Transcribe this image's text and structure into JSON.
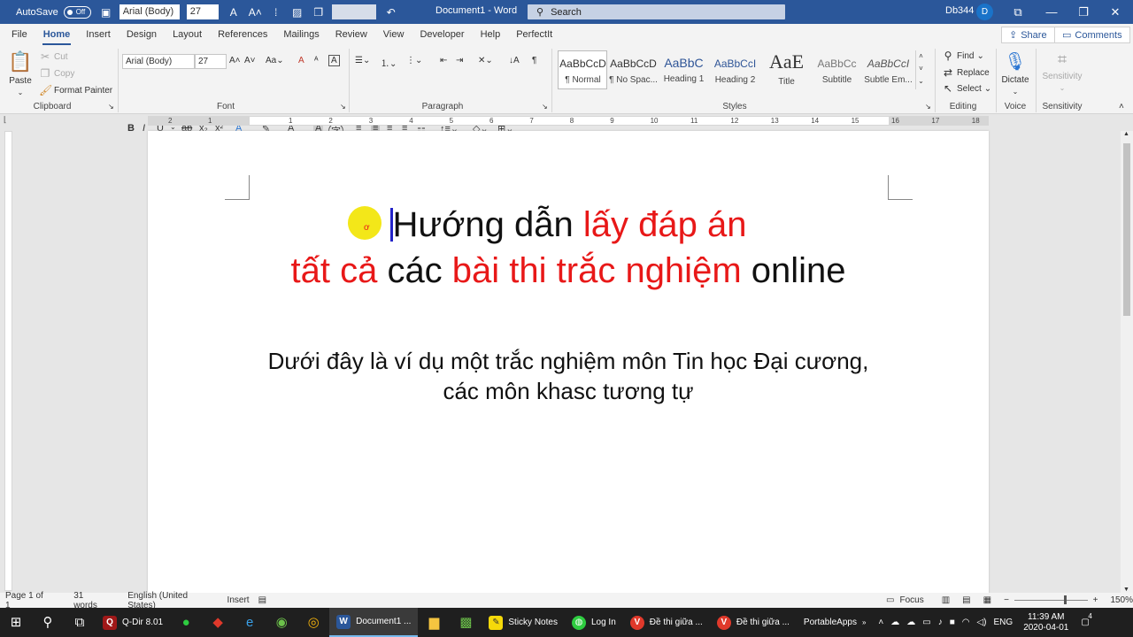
{
  "titlebar": {
    "autosave_label": "AutoSave",
    "autosave_state": "Off",
    "font_name": "Arial (Body)",
    "font_size": "27",
    "doc_title": "Document1 - Word",
    "search_placeholder": "Search",
    "user": "Db344",
    "avatar_initial": "D"
  },
  "menu": {
    "tabs": [
      "File",
      "Home",
      "Insert",
      "Design",
      "Layout",
      "References",
      "Mailings",
      "Review",
      "View",
      "Developer",
      "Help",
      "PerfectIt"
    ],
    "share": "Share",
    "comments": "Comments"
  },
  "ribbon": {
    "clipboard": {
      "paste": "Paste",
      "cut": "Cut",
      "copy": "Copy",
      "format_painter": "Format Painter",
      "label": "Clipboard"
    },
    "font": {
      "name": "Arial (Body)",
      "size": "27",
      "label": "Font"
    },
    "paragraph": {
      "label": "Paragraph"
    },
    "styles": {
      "label": "Styles",
      "items": [
        {
          "sample": "AaBbCcD",
          "name": "¶ Normal"
        },
        {
          "sample": "AaBbCcD",
          "name": "¶ No Spac..."
        },
        {
          "sample": "AaBbC",
          "name": "Heading 1"
        },
        {
          "sample": "AaBbCcI",
          "name": "Heading 2"
        },
        {
          "sample": "AaE",
          "name": "Title"
        },
        {
          "sample": "AaBbCc",
          "name": "Subtitle"
        },
        {
          "sample": "AaBbCcI",
          "name": "Subtle Em..."
        }
      ]
    },
    "editing": {
      "find": "Find",
      "replace": "Replace",
      "select": "Select",
      "label": "Editing"
    },
    "voice": {
      "dictate": "Dictate",
      "label": "Voice"
    },
    "sensitivity": {
      "button": "Sensitivity",
      "label": "Sensitivity"
    }
  },
  "ruler": {
    "marks": [
      "2",
      "1",
      "1",
      "2",
      "3",
      "4",
      "5",
      "6",
      "7",
      "8",
      "9",
      "10",
      "11",
      "12",
      "13",
      "14",
      "15",
      "16",
      "17",
      "18"
    ]
  },
  "document": {
    "heading_line1": [
      {
        "text": "Hướng dẫn ",
        "color": "black"
      },
      {
        "text": "lấy đáp án",
        "color": "red"
      }
    ],
    "heading_line2": [
      {
        "text": "tất cả ",
        "color": "red"
      },
      {
        "text": "các ",
        "color": "black"
      },
      {
        "text": "bài thi trắc nghiệm ",
        "color": "red"
      },
      {
        "text": "online",
        "color": "black"
      }
    ],
    "body_line1": "Dưới đây là ví dụ một trắc nghiệm môn Tin học Đại cương,",
    "body_line2": "các môn khasc tương tự"
  },
  "status": {
    "page": "Page 1 of 1",
    "words": "31 words",
    "language": "English (United States)",
    "mode": "Insert",
    "focus": "Focus",
    "zoom": "150%"
  },
  "taskbar": {
    "apps": [
      {
        "label": "Q-Dir 8.01"
      },
      {
        "label": "Document1 ..."
      },
      {
        "label": "Sticky Notes"
      },
      {
        "label": "Log In"
      },
      {
        "label": "Đề thi giữa ..."
      },
      {
        "label": "Đề thi giữa ..."
      },
      {
        "label": "PortableApps"
      }
    ],
    "lang": "ENG",
    "time": "11:39 AM",
    "date": "2020-04-01",
    "notif_count": "4"
  },
  "colors": {
    "word_blue": "#2b579a",
    "red_text": "#e81818",
    "highlight": "#f2e400"
  }
}
